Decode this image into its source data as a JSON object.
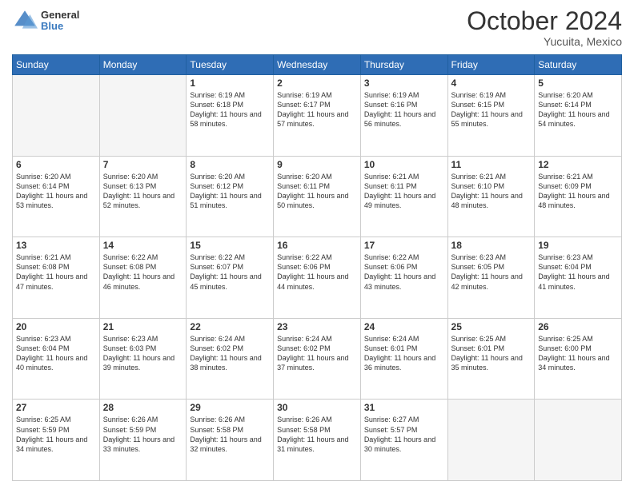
{
  "header": {
    "logo_line1": "General",
    "logo_line2": "Blue",
    "month": "October 2024",
    "location": "Yucuita, Mexico"
  },
  "days_of_week": [
    "Sunday",
    "Monday",
    "Tuesday",
    "Wednesday",
    "Thursday",
    "Friday",
    "Saturday"
  ],
  "weeks": [
    [
      {
        "day": "",
        "empty": true
      },
      {
        "day": "",
        "empty": true
      },
      {
        "day": "1",
        "sunrise": "Sunrise: 6:19 AM",
        "sunset": "Sunset: 6:18 PM",
        "daylight": "Daylight: 11 hours and 58 minutes."
      },
      {
        "day": "2",
        "sunrise": "Sunrise: 6:19 AM",
        "sunset": "Sunset: 6:17 PM",
        "daylight": "Daylight: 11 hours and 57 minutes."
      },
      {
        "day": "3",
        "sunrise": "Sunrise: 6:19 AM",
        "sunset": "Sunset: 6:16 PM",
        "daylight": "Daylight: 11 hours and 56 minutes."
      },
      {
        "day": "4",
        "sunrise": "Sunrise: 6:19 AM",
        "sunset": "Sunset: 6:15 PM",
        "daylight": "Daylight: 11 hours and 55 minutes."
      },
      {
        "day": "5",
        "sunrise": "Sunrise: 6:20 AM",
        "sunset": "Sunset: 6:14 PM",
        "daylight": "Daylight: 11 hours and 54 minutes."
      }
    ],
    [
      {
        "day": "6",
        "sunrise": "Sunrise: 6:20 AM",
        "sunset": "Sunset: 6:14 PM",
        "daylight": "Daylight: 11 hours and 53 minutes."
      },
      {
        "day": "7",
        "sunrise": "Sunrise: 6:20 AM",
        "sunset": "Sunset: 6:13 PM",
        "daylight": "Daylight: 11 hours and 52 minutes."
      },
      {
        "day": "8",
        "sunrise": "Sunrise: 6:20 AM",
        "sunset": "Sunset: 6:12 PM",
        "daylight": "Daylight: 11 hours and 51 minutes."
      },
      {
        "day": "9",
        "sunrise": "Sunrise: 6:20 AM",
        "sunset": "Sunset: 6:11 PM",
        "daylight": "Daylight: 11 hours and 50 minutes."
      },
      {
        "day": "10",
        "sunrise": "Sunrise: 6:21 AM",
        "sunset": "Sunset: 6:11 PM",
        "daylight": "Daylight: 11 hours and 49 minutes."
      },
      {
        "day": "11",
        "sunrise": "Sunrise: 6:21 AM",
        "sunset": "Sunset: 6:10 PM",
        "daylight": "Daylight: 11 hours and 48 minutes."
      },
      {
        "day": "12",
        "sunrise": "Sunrise: 6:21 AM",
        "sunset": "Sunset: 6:09 PM",
        "daylight": "Daylight: 11 hours and 48 minutes."
      }
    ],
    [
      {
        "day": "13",
        "sunrise": "Sunrise: 6:21 AM",
        "sunset": "Sunset: 6:08 PM",
        "daylight": "Daylight: 11 hours and 47 minutes."
      },
      {
        "day": "14",
        "sunrise": "Sunrise: 6:22 AM",
        "sunset": "Sunset: 6:08 PM",
        "daylight": "Daylight: 11 hours and 46 minutes."
      },
      {
        "day": "15",
        "sunrise": "Sunrise: 6:22 AM",
        "sunset": "Sunset: 6:07 PM",
        "daylight": "Daylight: 11 hours and 45 minutes."
      },
      {
        "day": "16",
        "sunrise": "Sunrise: 6:22 AM",
        "sunset": "Sunset: 6:06 PM",
        "daylight": "Daylight: 11 hours and 44 minutes."
      },
      {
        "day": "17",
        "sunrise": "Sunrise: 6:22 AM",
        "sunset": "Sunset: 6:06 PM",
        "daylight": "Daylight: 11 hours and 43 minutes."
      },
      {
        "day": "18",
        "sunrise": "Sunrise: 6:23 AM",
        "sunset": "Sunset: 6:05 PM",
        "daylight": "Daylight: 11 hours and 42 minutes."
      },
      {
        "day": "19",
        "sunrise": "Sunrise: 6:23 AM",
        "sunset": "Sunset: 6:04 PM",
        "daylight": "Daylight: 11 hours and 41 minutes."
      }
    ],
    [
      {
        "day": "20",
        "sunrise": "Sunrise: 6:23 AM",
        "sunset": "Sunset: 6:04 PM",
        "daylight": "Daylight: 11 hours and 40 minutes."
      },
      {
        "day": "21",
        "sunrise": "Sunrise: 6:23 AM",
        "sunset": "Sunset: 6:03 PM",
        "daylight": "Daylight: 11 hours and 39 minutes."
      },
      {
        "day": "22",
        "sunrise": "Sunrise: 6:24 AM",
        "sunset": "Sunset: 6:02 PM",
        "daylight": "Daylight: 11 hours and 38 minutes."
      },
      {
        "day": "23",
        "sunrise": "Sunrise: 6:24 AM",
        "sunset": "Sunset: 6:02 PM",
        "daylight": "Daylight: 11 hours and 37 minutes."
      },
      {
        "day": "24",
        "sunrise": "Sunrise: 6:24 AM",
        "sunset": "Sunset: 6:01 PM",
        "daylight": "Daylight: 11 hours and 36 minutes."
      },
      {
        "day": "25",
        "sunrise": "Sunrise: 6:25 AM",
        "sunset": "Sunset: 6:01 PM",
        "daylight": "Daylight: 11 hours and 35 minutes."
      },
      {
        "day": "26",
        "sunrise": "Sunrise: 6:25 AM",
        "sunset": "Sunset: 6:00 PM",
        "daylight": "Daylight: 11 hours and 34 minutes."
      }
    ],
    [
      {
        "day": "27",
        "sunrise": "Sunrise: 6:25 AM",
        "sunset": "Sunset: 5:59 PM",
        "daylight": "Daylight: 11 hours and 34 minutes."
      },
      {
        "day": "28",
        "sunrise": "Sunrise: 6:26 AM",
        "sunset": "Sunset: 5:59 PM",
        "daylight": "Daylight: 11 hours and 33 minutes."
      },
      {
        "day": "29",
        "sunrise": "Sunrise: 6:26 AM",
        "sunset": "Sunset: 5:58 PM",
        "daylight": "Daylight: 11 hours and 32 minutes."
      },
      {
        "day": "30",
        "sunrise": "Sunrise: 6:26 AM",
        "sunset": "Sunset: 5:58 PM",
        "daylight": "Daylight: 11 hours and 31 minutes."
      },
      {
        "day": "31",
        "sunrise": "Sunrise: 6:27 AM",
        "sunset": "Sunset: 5:57 PM",
        "daylight": "Daylight: 11 hours and 30 minutes."
      },
      {
        "day": "",
        "empty": true
      },
      {
        "day": "",
        "empty": true
      }
    ]
  ]
}
